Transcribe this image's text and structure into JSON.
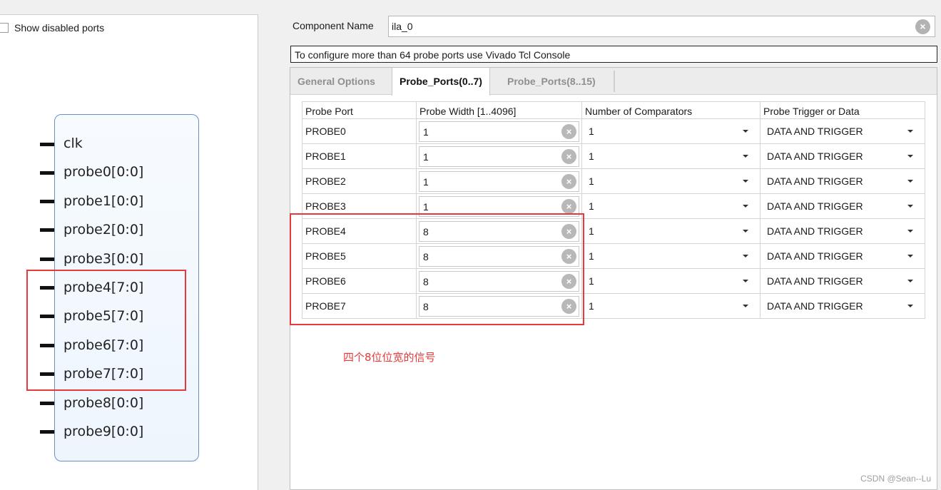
{
  "left": {
    "show_disabled_label": "Show disabled ports",
    "ports": [
      "clk",
      "probe0[0:0]",
      "probe1[0:0]",
      "probe2[0:0]",
      "probe3[0:0]",
      "probe4[7:0]",
      "probe5[7:0]",
      "probe6[7:0]",
      "probe7[7:0]",
      "probe8[0:0]",
      "probe9[0:0]"
    ]
  },
  "component": {
    "label": "Component Name",
    "value": "ila_0",
    "clear_icon": "clear-icon"
  },
  "notice": "To configure more than 64 probe ports use Vivado Tcl Console",
  "tabs": [
    {
      "label": "General Options",
      "active": false
    },
    {
      "label": "Probe_Ports(0..7)",
      "active": true
    },
    {
      "label": "Probe_Ports(8..15)",
      "active": false
    }
  ],
  "table": {
    "headers": [
      "Probe Port",
      "Probe Width [1..4096]",
      "Number of Comparators",
      "Probe Trigger or Data"
    ],
    "rows": [
      {
        "port": "PROBE0",
        "width": "1",
        "comparators": "1",
        "trigger": "DATA AND TRIGGER"
      },
      {
        "port": "PROBE1",
        "width": "1",
        "comparators": "1",
        "trigger": "DATA AND TRIGGER"
      },
      {
        "port": "PROBE2",
        "width": "1",
        "comparators": "1",
        "trigger": "DATA AND TRIGGER"
      },
      {
        "port": "PROBE3",
        "width": "1",
        "comparators": "1",
        "trigger": "DATA AND TRIGGER"
      },
      {
        "port": "PROBE4",
        "width": "8",
        "comparators": "1",
        "trigger": "DATA AND TRIGGER"
      },
      {
        "port": "PROBE5",
        "width": "8",
        "comparators": "1",
        "trigger": "DATA AND TRIGGER"
      },
      {
        "port": "PROBE6",
        "width": "8",
        "comparators": "1",
        "trigger": "DATA AND TRIGGER"
      },
      {
        "port": "PROBE7",
        "width": "8",
        "comparators": "1",
        "trigger": "DATA AND TRIGGER"
      }
    ]
  },
  "annotation": "四个8位位宽的信号",
  "watermark": "CSDN @Sean--Lu",
  "colors": {
    "highlight": "#e63a3a",
    "block_border": "#6d8fc8"
  }
}
